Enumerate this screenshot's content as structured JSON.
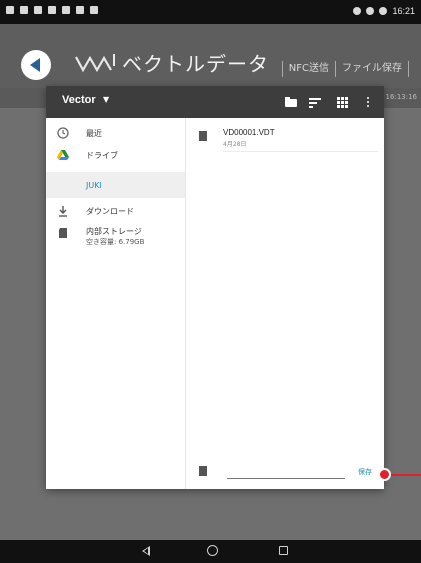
{
  "status_bar": {
    "time": "16:21"
  },
  "app": {
    "title": "ベクトルデータ",
    "actions": [
      "NFC送信",
      "ファイル保存"
    ],
    "subbar_time": "16:13:16"
  },
  "dialog": {
    "toolbar_title": "Vector",
    "sidebar": [
      {
        "icon": "clock-icon",
        "label": "最近"
      },
      {
        "icon": "drive-icon",
        "label": "ドライブ"
      },
      {
        "icon": "",
        "label": "JUKI",
        "selected": true
      },
      {
        "icon": "download-icon",
        "label": "ダウンロード"
      },
      {
        "icon": "storage-icon",
        "label": "内部ストレージ",
        "sublabel": "空き容量: 6.79GB"
      }
    ],
    "files": [
      {
        "name": "VD00001.VDT",
        "date": "4月28日"
      }
    ],
    "filename_value": "",
    "save_label": "保存"
  }
}
